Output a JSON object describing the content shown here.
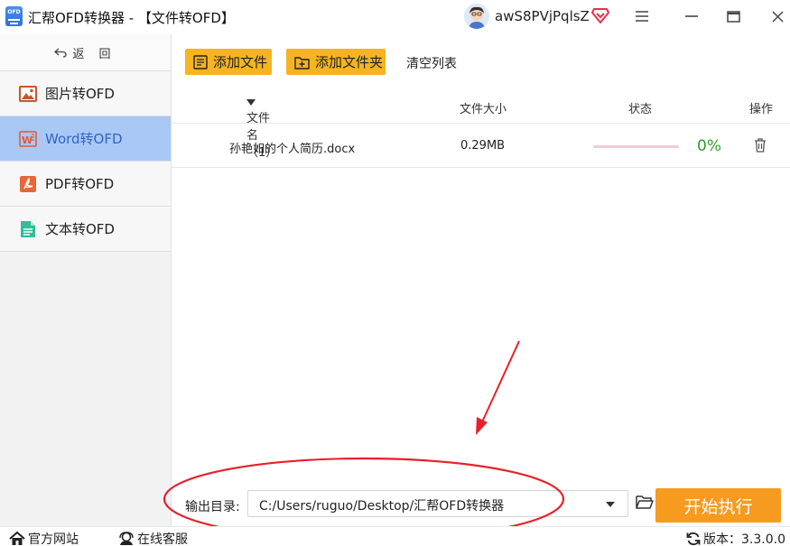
{
  "window": {
    "title": "汇帮OFD转换器 - 【文件转OFD】",
    "logo_text": "OFD",
    "username": "awS8PVjPqlsZ"
  },
  "sidebar": {
    "back_label": "返 回",
    "items": [
      {
        "label": "图片转OFD",
        "icon": "image-icon",
        "active": false
      },
      {
        "label": "Word转OFD",
        "icon": "word-icon",
        "active": true
      },
      {
        "label": "PDF转OFD",
        "icon": "pdf-icon",
        "active": false
      },
      {
        "label": "文本转OFD",
        "icon": "text-file-icon",
        "active": false
      }
    ]
  },
  "toolbar": {
    "add_file": "添加文件",
    "add_folder": "添加文件夹",
    "clear_list": "清空列表"
  },
  "table": {
    "columns": {
      "filename": "文件名（1）",
      "size": "文件大小",
      "status": "状态",
      "action": "操作"
    },
    "rows": [
      {
        "filename": "孙艳如的个人简历.docx",
        "size": "0.29MB",
        "progress": 0,
        "progress_text": "0%"
      }
    ]
  },
  "output": {
    "label": "输出目录:",
    "path": "C:/Users/ruguo/Desktop/汇帮OFD转换器"
  },
  "start_button": "开始执行",
  "statusbar": {
    "website": "官方网站",
    "support": "在线客服",
    "version": "版本：3.3.0.0"
  },
  "colors": {
    "accent_yellow": "#f5b420",
    "start_orange": "#f79b20",
    "active_nav": "#a9c8f5",
    "progress_green": "#2c9e2c",
    "annotation_red": "#e8202a"
  }
}
